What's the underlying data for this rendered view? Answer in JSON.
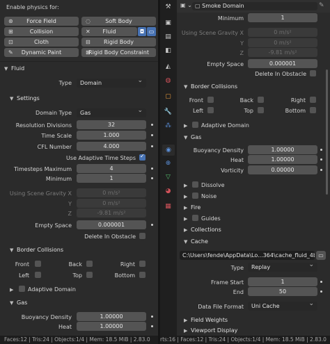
{
  "left": {
    "enable_label": "Enable physics for:",
    "physics_buttons": [
      {
        "label": "Force Field",
        "icon": "force-field-icon"
      },
      {
        "label": "Soft Body",
        "icon": "soft-body-icon"
      },
      {
        "label": "Collision",
        "icon": "collision-icon"
      },
      {
        "label": "Fluid",
        "icon": "fluid-close-icon",
        "active": true
      },
      {
        "label": "Cloth",
        "icon": "cloth-icon"
      },
      {
        "label": "Rigid Body",
        "icon": "rigid-body-icon"
      },
      {
        "label": "Dynamic Paint",
        "icon": "dynamic-paint-icon"
      },
      {
        "label": "Rigid Body Constraint",
        "icon": "constraint-icon"
      }
    ],
    "fluid_section": "Fluid",
    "type_label": "Type",
    "type_value": "Domain",
    "settings_section": "Settings",
    "domain_type_label": "Domain Type",
    "domain_type_value": "Gas",
    "resolution_label": "Resolution Divisions",
    "resolution_value": "32",
    "time_scale_label": "Time Scale",
    "time_scale_value": "1.000",
    "cfl_label": "CFL Number",
    "cfl_value": "4.000",
    "adaptive_time_label": "Use Adaptive Time Steps",
    "timesteps_max_label": "Timesteps Maximum",
    "timesteps_max_value": "4",
    "minimum_label": "Minimum",
    "minimum_value": "1",
    "gravity_label": "Using Scene Gravity X",
    "gravity_x": "0 m/s²",
    "gravity_y_label": "Y",
    "gravity_y": "0 m/s²",
    "gravity_z_label": "Z",
    "gravity_z": "-9.81 m/s²",
    "empty_space_label": "Empty Space",
    "empty_space_value": "0.000001",
    "delete_obstacle_label": "Delete In Obstacle",
    "border_section": "Border Collisions",
    "border": {
      "front": "Front",
      "back": "Back",
      "right": "Right",
      "left": "Left",
      "top": "Top",
      "bottom": "Bottom"
    },
    "adaptive_domain_section": "Adaptive Domain",
    "gas_section": "Gas",
    "buoyancy_density_label": "Buoyancy Density",
    "buoyancy_density_value": "1.00000",
    "heat_label": "Heat",
    "heat_value": "1.00000",
    "status": "Faces:12 | Tris:24 | Objects:1/4 | Mem: 18.5 MiB | 2.83.0"
  },
  "right": {
    "object_name": "Smoke Domain",
    "minimum_label": "Minimum",
    "minimum_value": "1",
    "gravity_label": "Using Scene Gravity X",
    "gravity_x": "0 m/s²",
    "gravity_y_label": "Y",
    "gravity_y": "0 m/s²",
    "gravity_z_label": "Z",
    "gravity_z": "-9.81 m/s²",
    "empty_space_label": "Empty Space",
    "empty_space_value": "0.000001",
    "delete_obstacle_label": "Delete In Obstacle",
    "border_section": "Border Collisions",
    "border": {
      "front": "Front",
      "back": "Back",
      "right": "Right",
      "left": "Left",
      "top": "Top",
      "bottom": "Bottom"
    },
    "adaptive_domain_section": "Adaptive Domain",
    "gas_section": "Gas",
    "buoyancy_density_label": "Buoyancy Density",
    "buoyancy_density_value": "1.00000",
    "heat_label": "Heat",
    "heat_value": "1.00000",
    "vorticity_label": "Vorticity",
    "vorticity_value": "0.00000",
    "dissolve_section": "Dissolve",
    "noise_section": "Noise",
    "fire_section": "Fire",
    "guides_section": "Guides",
    "collections_section": "Collections",
    "cache_section": "Cache",
    "cache_path": "C:\\Users\\fende\\AppData\\Lo...364\\cache_fluid_4b85f272",
    "cache_type_label": "Type",
    "cache_type_value": "Replay",
    "frame_start_label": "Frame Start",
    "frame_start_value": "1",
    "end_label": "End",
    "end_value": "50",
    "data_format_label": "Data File Format",
    "data_format_value": "Uni Cache",
    "field_weights_section": "Field Weights",
    "viewport_display_section": "Viewport Display",
    "status": "rts:16 | Faces:12 | Tris:24 | Objects:1/4 | Mem: 18.5 MiB | 2.83.0"
  },
  "colors": {
    "accent": "#4772b3",
    "panel": "#2b2b2b",
    "field": "#545454",
    "dropdown": "#282828"
  }
}
